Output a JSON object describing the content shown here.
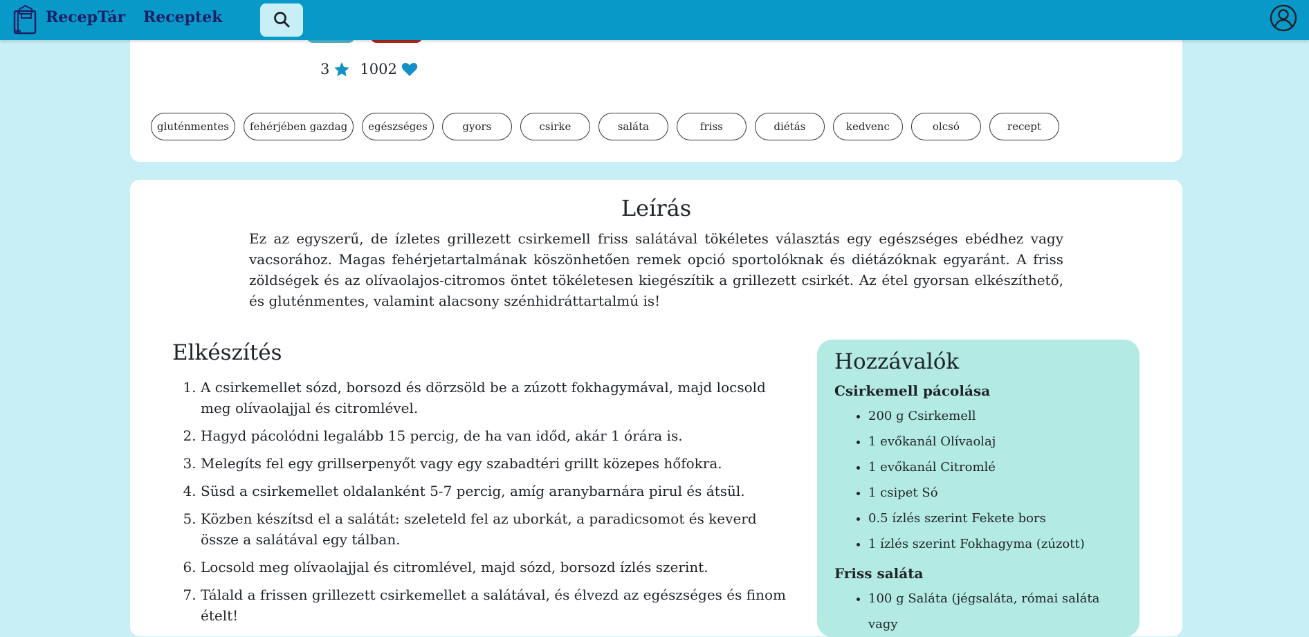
{
  "nav": {
    "brand": "RecepTár",
    "recipes_link": "Receptek"
  },
  "stats": {
    "rating": "3",
    "likes": "1002"
  },
  "tags": [
    "gluténmentes",
    "fehérjében gazdag",
    "egészséges",
    "gyors",
    "csirke",
    "saláta",
    "friss",
    "diétás",
    "kedvenc",
    "olcsó",
    "recept"
  ],
  "description": {
    "title": "Leírás",
    "text": "Ez az egyszerű, de ízletes grillezett csirkemell friss salátával tökéletes választás egy egészséges ebédhez vagy vacsorához. Magas fehérjetartalmának köszönhetően remek opció sportolóknak és diétázóknak egyaránt. A friss zöldségek és az olívaolajos-citromos öntet tökéletesen kiegészítik a grillezett csirkét. Az étel gyorsan elkészíthető, és gluténmentes, valamint alacsony szénhidráttartalmú is!"
  },
  "preparation": {
    "title": "Elkészítés",
    "steps": [
      "A csirkemellet sózd, borsozd és dörzsöld be a zúzott fokhagymával, majd locsold meg olívaolajjal és citromlével.",
      "Hagyd pácolódni legalább 15 percig, de ha van időd, akár 1 órára is.",
      "Melegíts fel egy grillserpenyőt vagy egy szabadtéri grillt közepes hőfokra.",
      "Süsd a csirkemellet oldalanként 5-7 percig, amíg aranybarnára pirul és átsül.",
      "Közben készítsd el a salátát: szeleteld fel az uborkát, a paradicsomot és keverd össze a salátával egy tálban.",
      "Locsold meg olívaolajjal és citromlével, majd sózd, borsozd ízlés szerint.",
      "Tálald a frissen grillezett csirkemellet a salátával, és élvezd az egészséges és finom ételt!"
    ]
  },
  "ingredients": {
    "title": "Hozzávalók",
    "groups": [
      {
        "name": "Csirkemell pácolása",
        "items": [
          "200 g Csirkemell",
          "1 evőkanál Olívaolaj",
          "1 evőkanál Citromlé",
          "1 csipet Só",
          "0.5 ízlés szerint Fekete bors",
          "1 ízlés szerint Fokhagyma (zúzott)"
        ]
      },
      {
        "name": "Friss saláta",
        "items": [
          "100 g Saláta (jégsaláta, római saláta vagy"
        ]
      }
    ]
  },
  "colors": {
    "navbar": "#0899c9",
    "background": "#c7eff5",
    "ingredients_panel": "#b3ebe4",
    "brand_text": "#1b1f66"
  }
}
